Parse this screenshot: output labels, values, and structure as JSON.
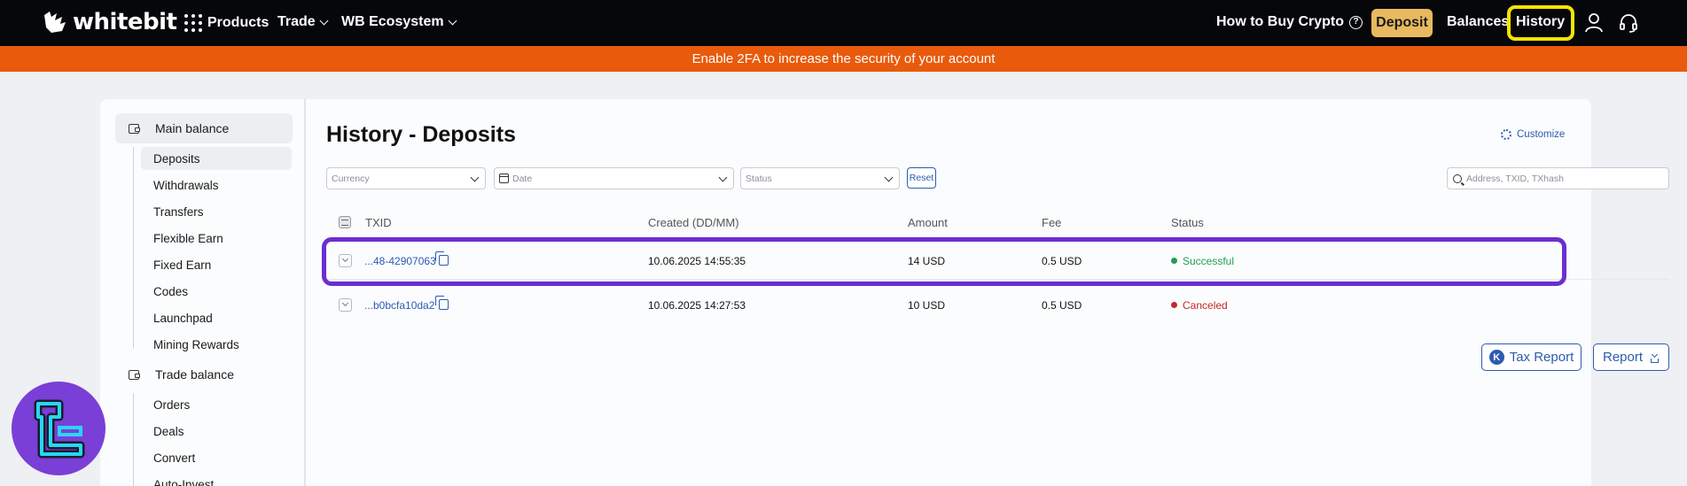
{
  "header": {
    "brand": "whitebit",
    "nav": {
      "products": "Products",
      "trade": "Trade",
      "ecosystem": "WB Ecosystem"
    },
    "how_to_buy": "How to Buy Crypto",
    "deposit": "Deposit",
    "balances": "Balances",
    "history": "History"
  },
  "banner": {
    "text": "Enable 2FA to increase the security of your account"
  },
  "sidebar": {
    "main_balance": "Main balance",
    "main_items": [
      "Deposits",
      "Withdrawals",
      "Transfers",
      "Flexible Earn",
      "Fixed Earn",
      "Codes",
      "Launchpad",
      "Mining Rewards"
    ],
    "trade_balance": "Trade balance",
    "trade_items": [
      "Orders",
      "Deals",
      "Convert",
      "Auto-Invest"
    ]
  },
  "main": {
    "title": "History - Deposits",
    "customize": "Customize",
    "filters": {
      "currency": "Currency",
      "date": "Date",
      "status": "Status",
      "reset": "Reset",
      "search_placeholder": "Address, TXID, TXhash"
    },
    "columns": {
      "txid": "TXID",
      "created": "Created (DD/MM)",
      "amount": "Amount",
      "fee": "Fee",
      "status": "Status"
    },
    "rows": [
      {
        "txid": "...48-42907063",
        "created": "10.06.2025 14:55:35",
        "amount": "14 USD",
        "fee": "0.5 USD",
        "status": "Successful"
      },
      {
        "txid": "...b0bcfa10da2",
        "created": "10.06.2025 14:27:53",
        "amount": "10 USD",
        "fee": "0.5 USD",
        "status": "Canceled"
      }
    ],
    "tax_report": "Tax Report",
    "report": "Report"
  },
  "colors": {
    "accent": "#2d5bb0",
    "banner": "#e95a0c",
    "deposit_button": "#e8b961",
    "highlight_history": "#f5e400",
    "highlight_row": "#6a2fd1",
    "success": "#1f9d55",
    "canceled": "#c62828"
  }
}
